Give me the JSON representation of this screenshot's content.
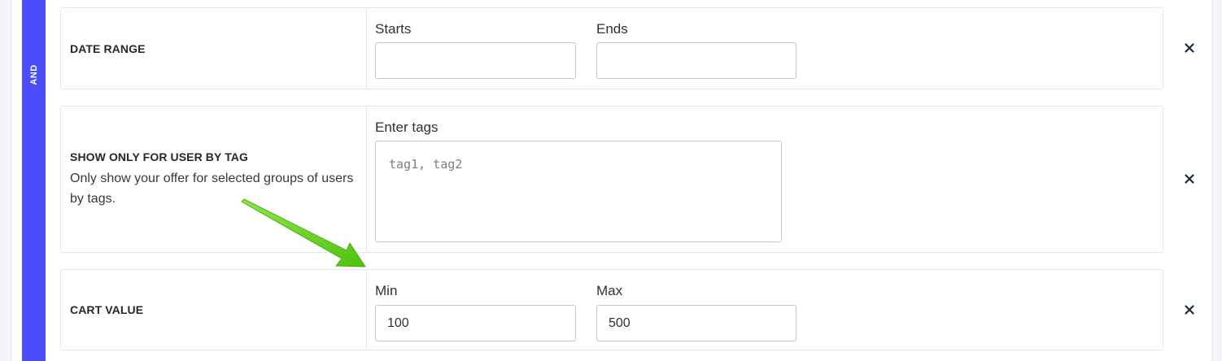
{
  "group": {
    "operator_label": "AND",
    "accent_color": "#4a4df9"
  },
  "conditions": [
    {
      "title": "DATE RANGE",
      "fields": [
        {
          "label": "Starts",
          "value": ""
        },
        {
          "label": "Ends",
          "value": ""
        }
      ],
      "remove_icon": "close-icon"
    },
    {
      "title": "SHOW ONLY FOR USER BY TAG",
      "description": "Only show your offer for selected groups of users by tags.",
      "field": {
        "label": "Enter tags",
        "value": "",
        "placeholder": "tag1, tag2"
      },
      "remove_icon": "close-icon"
    },
    {
      "title": "CART VALUE",
      "fields": [
        {
          "label": "Min",
          "value": "100"
        },
        {
          "label": "Max",
          "value": "500"
        }
      ],
      "remove_icon": "close-icon"
    }
  ],
  "annotation": {
    "icon": "green-arrow-icon",
    "color": "#5fd41a"
  }
}
